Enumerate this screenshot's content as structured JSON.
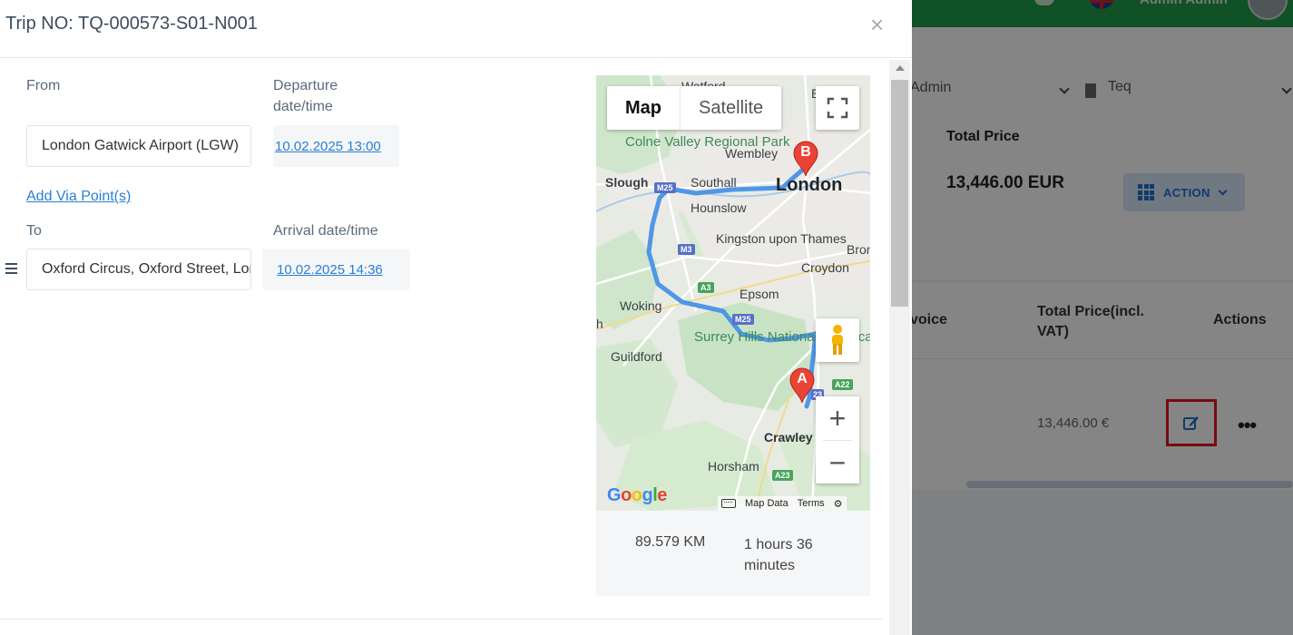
{
  "modal": {
    "title": "Trip NO: TQ-000573-S01-N001",
    "close_symbol": "×",
    "from_label": "From",
    "from_value": "London Gatwick Airport (LGW)",
    "departure_label": "Departure date/time",
    "departure_value": "10.02.2025 13:00",
    "add_via_label": "Add Via Point(s)",
    "to_label": "To",
    "to_value": "Oxford Circus, Oxford Street, London",
    "arrival_label": "Arrival date/time",
    "arrival_value": "10.02.2025 14:36"
  },
  "map": {
    "type_map": "Map",
    "type_satellite": "Satellite",
    "zoom_in": "+",
    "zoom_out": "−",
    "marker_a": "A",
    "marker_b": "B",
    "labels": {
      "watford": "Watford",
      "colne_valley": "Colne Valley Regional Park",
      "wembley": "Wembley",
      "slough": "Slough",
      "southall": "Southall",
      "london": "London",
      "hounslow": "Hounslow",
      "kingston": "Kingston upon Thames",
      "bromley": "Brom",
      "croydon": "Croydon",
      "epsom": "Epsom",
      "woking": "Woking",
      "surrey_hills": "Surrey Hills National Landscape",
      "guildford": "Guildford",
      "crawley": "Crawley",
      "horsham": "Horsham",
      "partial_h": "h",
      "partial_e": "E"
    },
    "roads": {
      "m25_a": "M25",
      "m3": "M3",
      "a3": "A3",
      "m25_b": "M25",
      "a22": "A22",
      "a23": "A23",
      "a23_b": "23"
    },
    "google_logo": "Google",
    "map_data": "Map Data",
    "terms": "Terms"
  },
  "route_info": {
    "distance": "89.579 KM",
    "duration": "1 hours 36 minutes"
  },
  "background": {
    "user_name": "Admin Admin",
    "filter_user": "Admin",
    "filter_company": "Teq",
    "total_price_label": "Total Price",
    "total_price_value": "13,446.00 EUR",
    "action_label": "ACTION",
    "col_invoice": "voice",
    "col_total_vat": "Total Price(incl. VAT)",
    "col_actions": "Actions",
    "row_total": "13,446.00 €",
    "more_symbol": "•••"
  },
  "colors": {
    "brand_green": "#1f9c4a",
    "link_blue": "#2a7fd4",
    "highlight_red": "#e3161c",
    "route_blue": "#4f97e6"
  }
}
